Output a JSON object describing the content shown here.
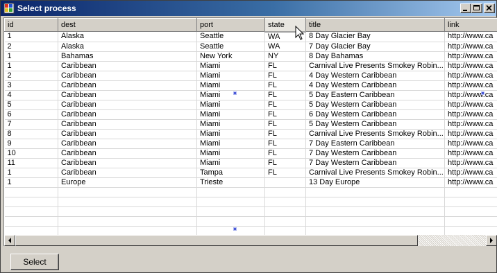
{
  "window": {
    "title": "Select process",
    "icons": {
      "app": "app-icon",
      "minimize": "minimize-icon",
      "maximize": "maximize-icon",
      "close": "close-icon"
    }
  },
  "grid": {
    "columns": [
      "id",
      "dest",
      "port",
      "state",
      "title",
      "link"
    ],
    "rows": [
      [
        "1",
        "Alaska",
        "Seattle",
        "WA",
        "8 Day Glacier Bay",
        "http://www.ca"
      ],
      [
        "2",
        "Alaska",
        "Seattle",
        "WA",
        "7 Day Glacier Bay",
        "http://www.ca"
      ],
      [
        "1",
        "Bahamas",
        "New York",
        "NY",
        "8 Day Bahamas",
        "http://www.ca"
      ],
      [
        "1",
        "Caribbean",
        "Miami",
        "FL",
        "Carnival Live Presents Smokey Robin...",
        "http://www.ca"
      ],
      [
        "2",
        "Caribbean",
        "Miami",
        "FL",
        "4 Day Western Caribbean",
        "http://www.ca"
      ],
      [
        "3",
        "Caribbean",
        "Miami",
        "FL",
        "4 Day Western Caribbean",
        "http://www.ca"
      ],
      [
        "4",
        "Caribbean",
        "Miami",
        "FL",
        "5 Day Eastern Caribbean",
        "http://www.ca"
      ],
      [
        "5",
        "Caribbean",
        "Miami",
        "FL",
        "5 Day Western Caribbean",
        "http://www.ca"
      ],
      [
        "6",
        "Caribbean",
        "Miami",
        "FL",
        "6 Day Western Caribbean",
        "http://www.ca"
      ],
      [
        "7",
        "Caribbean",
        "Miami",
        "FL",
        "5 Day Western Caribbean",
        "http://www.ca"
      ],
      [
        "8",
        "Caribbean",
        "Miami",
        "FL",
        "Carnival Live Presents Smokey Robin...",
        "http://www.ca"
      ],
      [
        "9",
        "Caribbean",
        "Miami",
        "FL",
        "7 Day Eastern Caribbean",
        "http://www.ca"
      ],
      [
        "10",
        "Caribbean",
        "Miami",
        "FL",
        "7 Day Western Caribbean",
        "http://www.ca"
      ],
      [
        "11",
        "Caribbean",
        "Miami",
        "FL",
        "7 Day Western Caribbean",
        "http://www.ca"
      ],
      [
        "1",
        "Caribbean",
        "Tampa",
        "FL",
        "Carnival Live Presents Smokey Robin...",
        "http://www.ca"
      ],
      [
        "1",
        "Europe",
        "Trieste",
        "",
        "13 Day Europe",
        "http://www.ca"
      ]
    ],
    "empty_rows": 5,
    "hovered_column": "state"
  },
  "scrollbar": {
    "left_icon": "arrow-left-icon",
    "right_icon": "arrow-right-icon"
  },
  "actions": {
    "select_label": "Select"
  },
  "colors": {
    "title_start": "#0a246a",
    "title_end": "#a6caf0",
    "face": "#d4d0c8"
  }
}
